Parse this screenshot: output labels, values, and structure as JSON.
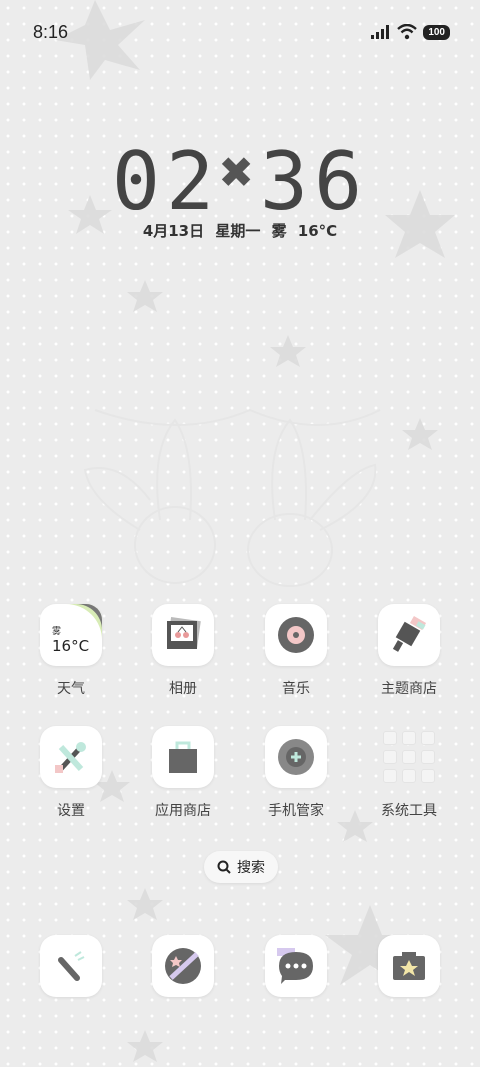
{
  "status_bar": {
    "time": "8:16",
    "battery": "100"
  },
  "clock": {
    "hours": "02",
    "minutes": "36"
  },
  "date_line": "4月13日 星期一 雾 16°C",
  "weather_widget": {
    "condition": "雾",
    "temp": "16°C"
  },
  "apps_row1": [
    {
      "label": "天气",
      "icon": "weather-icon"
    },
    {
      "label": "相册",
      "icon": "gallery-icon"
    },
    {
      "label": "音乐",
      "icon": "music-icon"
    },
    {
      "label": "主题商店",
      "icon": "theme-store-icon"
    }
  ],
  "apps_row2": [
    {
      "label": "设置",
      "icon": "settings-icon"
    },
    {
      "label": "应用商店",
      "icon": "app-store-icon"
    },
    {
      "label": "手机管家",
      "icon": "phone-manager-icon"
    },
    {
      "label": "系统工具",
      "icon": "system-tools-folder-icon"
    }
  ],
  "search": {
    "label": "搜索"
  },
  "dock": [
    {
      "icon": "phone-icon"
    },
    {
      "icon": "browser-icon"
    },
    {
      "icon": "messages-icon"
    },
    {
      "icon": "camera-icon"
    }
  ],
  "colors": {
    "accent_green": "#d8ecb6",
    "icon_gray": "#666666",
    "mint": "#bfe8dc",
    "pink": "#f3c7c7"
  }
}
